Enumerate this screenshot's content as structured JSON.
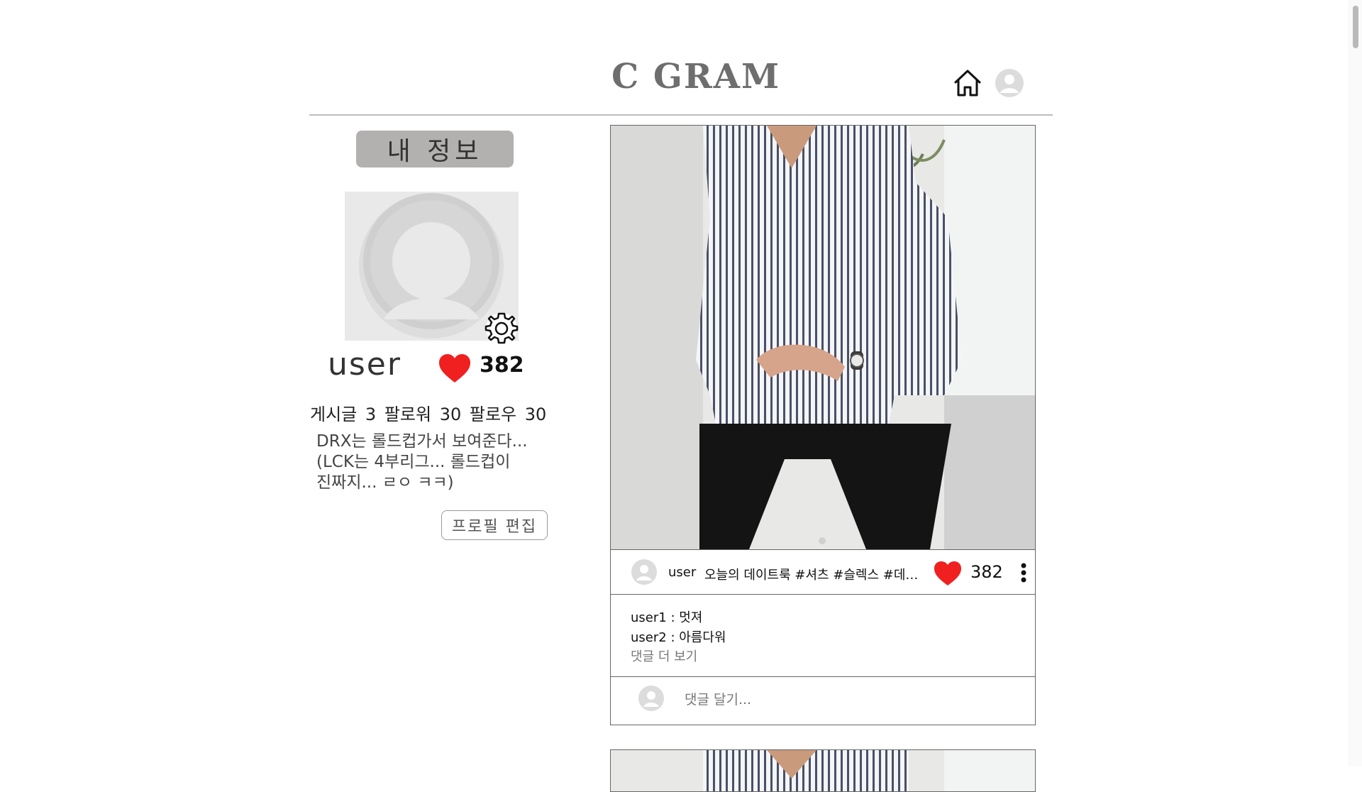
{
  "header": {
    "logo": "C GRAM",
    "home_icon": "home-icon",
    "avatar_icon": "user-avatar-icon"
  },
  "profile": {
    "section_title": "내 정보",
    "username": "user",
    "likes": "382",
    "stats": {
      "posts_label": "게시글",
      "posts": "3",
      "followers_label": "팔로워",
      "followers": "30",
      "following_label": "팔로우",
      "following": "30"
    },
    "bio": [
      "DRX는 롤드컵가서 보여준다...",
      "(LCK는 4부리그... 롤드컵이",
      "진짜지... ㄹㅇ ㅋㅋ)"
    ],
    "edit_button": "프로필 편집"
  },
  "post": {
    "user": "user",
    "caption": "오늘의 데이트룩 #셔츠 #슬렉스 #데이트룩",
    "likes": "382",
    "comments": [
      {
        "user": "user1",
        "text": "멋져"
      },
      {
        "user": "user2",
        "text": "아름다워"
      }
    ],
    "view_more": "댓글 더 보기",
    "comment_placeholder": "댓글 달기..."
  },
  "colors": {
    "like_red": "#f02020",
    "title_bg": "#b3b0b0",
    "logo": "#6e6e6e"
  }
}
